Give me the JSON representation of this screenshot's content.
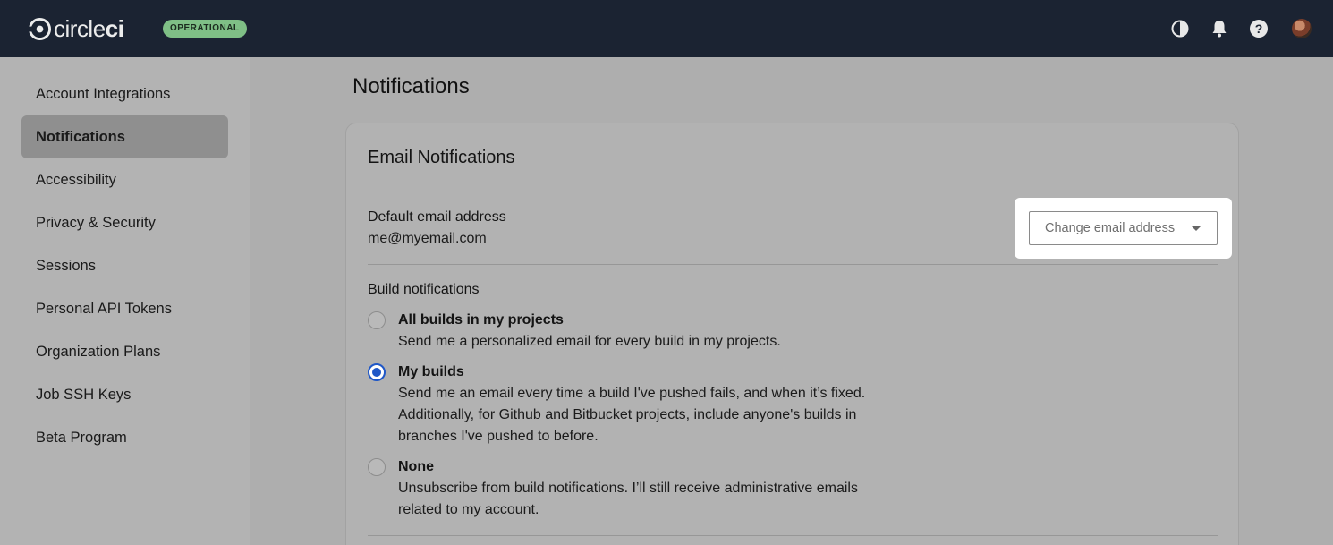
{
  "header": {
    "logo_text_light": "circle",
    "logo_text_bold": "ci",
    "status": "OPERATIONAL"
  },
  "sidebar": {
    "items": [
      {
        "label": "Account Integrations"
      },
      {
        "label": "Notifications",
        "active": true
      },
      {
        "label": "Accessibility"
      },
      {
        "label": "Privacy & Security"
      },
      {
        "label": "Sessions"
      },
      {
        "label": "Personal API Tokens"
      },
      {
        "label": "Organization Plans"
      },
      {
        "label": "Job SSH Keys"
      },
      {
        "label": "Beta Program"
      }
    ]
  },
  "main": {
    "title": "Notifications",
    "card": {
      "title": "Email Notifications",
      "default_email_label": "Default email address",
      "default_email_value": "me@myemail.com",
      "change_email_placeholder": "Change email address",
      "build_notifications_label": "Build notifications",
      "options": [
        {
          "title": "All builds in my projects",
          "lines": [
            "Send me a personalized email for every build in my projects."
          ],
          "selected": false
        },
        {
          "title": "My builds",
          "lines": [
            "Send me an email every time a build I've pushed fails, and when it’s fixed.",
            "Additionally, for Github and Bitbucket projects, include anyone's builds in",
            "branches I've pushed to before."
          ],
          "selected": true
        },
        {
          "title": "None",
          "lines": [
            "Unsubscribe from build notifications. I’ll still receive administrative emails",
            "related to my account."
          ],
          "selected": false
        }
      ]
    }
  },
  "colors": {
    "topbar": "#1b2332",
    "status_badge": "#7fbf86",
    "radio_selected": "#1f57c7"
  }
}
